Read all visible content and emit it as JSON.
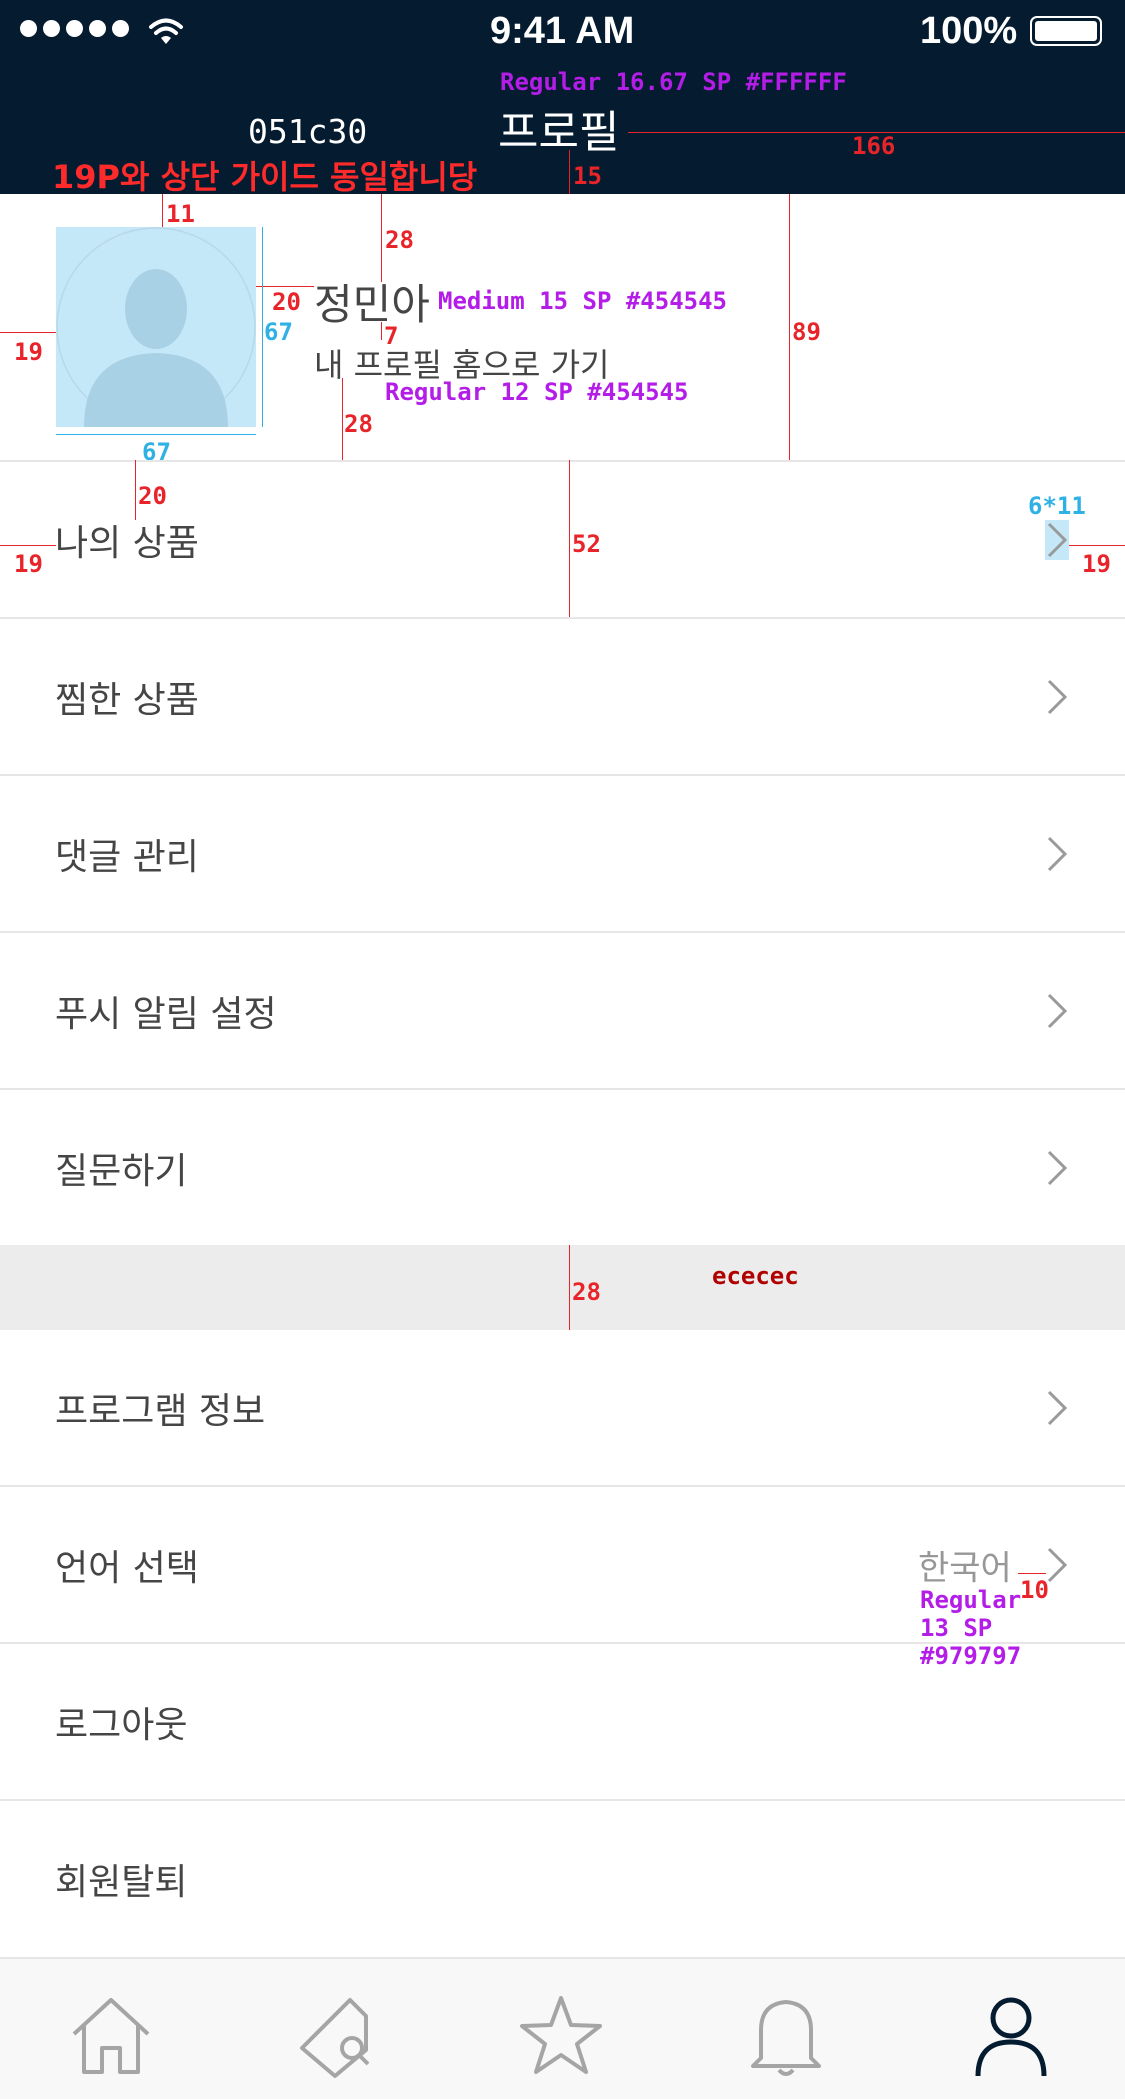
{
  "status_bar": {
    "time": "9:41 AM",
    "battery": "100%"
  },
  "header": {
    "title": "프로필",
    "bg_color": "#051c30"
  },
  "profile": {
    "name": "정민아",
    "link": "내 프로필 홈으로 가기"
  },
  "menu_group_1": [
    {
      "label": "나의 상품",
      "chevron": true
    },
    {
      "label": "찜한 상품",
      "chevron": true
    },
    {
      "label": "댓글 관리",
      "chevron": true
    },
    {
      "label": "푸시 알림 설정",
      "chevron": true
    },
    {
      "label": "질문하기",
      "chevron": true
    }
  ],
  "menu_group_2": [
    {
      "label": "프로그램 정보",
      "chevron": true
    },
    {
      "label": "언어 선택",
      "chevron": true,
      "value": "한국어"
    },
    {
      "label": "로그아웃",
      "chevron": false
    },
    {
      "label": "회원탈퇴",
      "chevron": false
    }
  ],
  "tab_bar": [
    {
      "icon": "home-icon",
      "active": false
    },
    {
      "icon": "tag-search-icon",
      "active": false
    },
    {
      "icon": "star-icon",
      "active": false
    },
    {
      "icon": "bell-icon",
      "active": false
    },
    {
      "icon": "person-icon",
      "active": true
    }
  ],
  "annotations": {
    "header_bg": "051c30",
    "header_font": "Regular 16.67 SP #FFFFFF",
    "guide_note": "19P와 상단 가이드 동일합니당",
    "name_font": "Medium 15 SP #454545",
    "link_font": "Regular 12 SP #454545",
    "separator_color": "ececec",
    "lang_font_1": "Regular",
    "lang_font_2": "13 SP",
    "lang_font_3": "#979797",
    "chevron_size": "6*11",
    "m_15": "15",
    "m_166": "166",
    "m_11": "11",
    "m_28a": "28",
    "m_20a": "20",
    "m_67a": "67",
    "m_67b": "67",
    "m_19a": "19",
    "m_7": "7",
    "m_28b": "28",
    "m_89": "89",
    "m_20b": "20",
    "m_52": "52",
    "m_19b": "19",
    "m_19c": "19",
    "m_28c": "28",
    "m_10": "10"
  },
  "colors": {
    "header": "#051c30",
    "text": "#454545",
    "muted": "#979797",
    "separator": "#ececec",
    "annotation_red": "#e8242a",
    "annotation_purple": "#b41ce8",
    "annotation_cyan": "#2fb1e6"
  }
}
